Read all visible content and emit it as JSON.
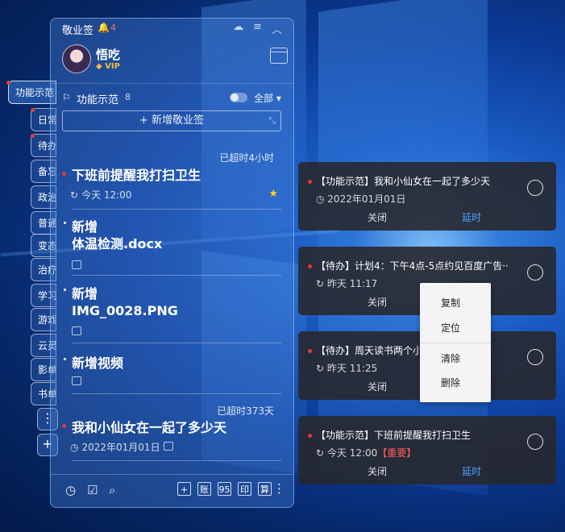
{
  "app": {
    "title": "敬业签",
    "bell_count": "4"
  },
  "user": {
    "name": "悟吃",
    "badge": "VIP"
  },
  "category": {
    "name": "功能示范",
    "count": "8",
    "filter": "全部"
  },
  "add_button": "+ 新增敬业签",
  "side_tabs": [
    "功能示范",
    "日常",
    "待办",
    "备忘",
    "政治",
    "普通",
    "变态",
    "治疗",
    "学习",
    "游戏",
    "云灵",
    "影单",
    "书单"
  ],
  "items": [
    {
      "overdue": "已超时4小时",
      "title": "下班前提醒我打扫卫生",
      "meta": "今天 12:00",
      "starred": true
    },
    {
      "title_line1": "新增",
      "title_line2": "体温检测.docx"
    },
    {
      "title_line1": "新增",
      "title_line2": "IMG_0028.PNG"
    },
    {
      "title": "新增视频"
    },
    {
      "overdue": "已超时373天",
      "title": "我和小仙女在一起了多少天",
      "meta": "2022年01月01日"
    }
  ],
  "footer": {
    "tools": [
      "+",
      "账",
      "95",
      "印",
      "算"
    ]
  },
  "notifications": [
    {
      "title": "【功能示范】我和小仙女在一起了多少天",
      "meta": "2022年01月01日",
      "tag": "",
      "close": "关闭",
      "delay": "延时"
    },
    {
      "title": "【待办】计划4：下午4点-5点约见百度广告··",
      "meta": "昨天 11:17",
      "tag": "",
      "close": "关闭",
      "delay": ""
    },
    {
      "title": "【待办】周天读书两个小",
      "meta": "昨天 11:25",
      "tag": "",
      "close": "关闭",
      "delay": ""
    },
    {
      "title": "【功能示范】下班前提醒我打扫卫生",
      "meta": "今天 12:00",
      "tag": "【重要】",
      "close": "关闭",
      "delay": "延时"
    }
  ],
  "context_menu": {
    "copy": "复制",
    "locate": "定位",
    "clear": "清除",
    "delete": "删除"
  }
}
